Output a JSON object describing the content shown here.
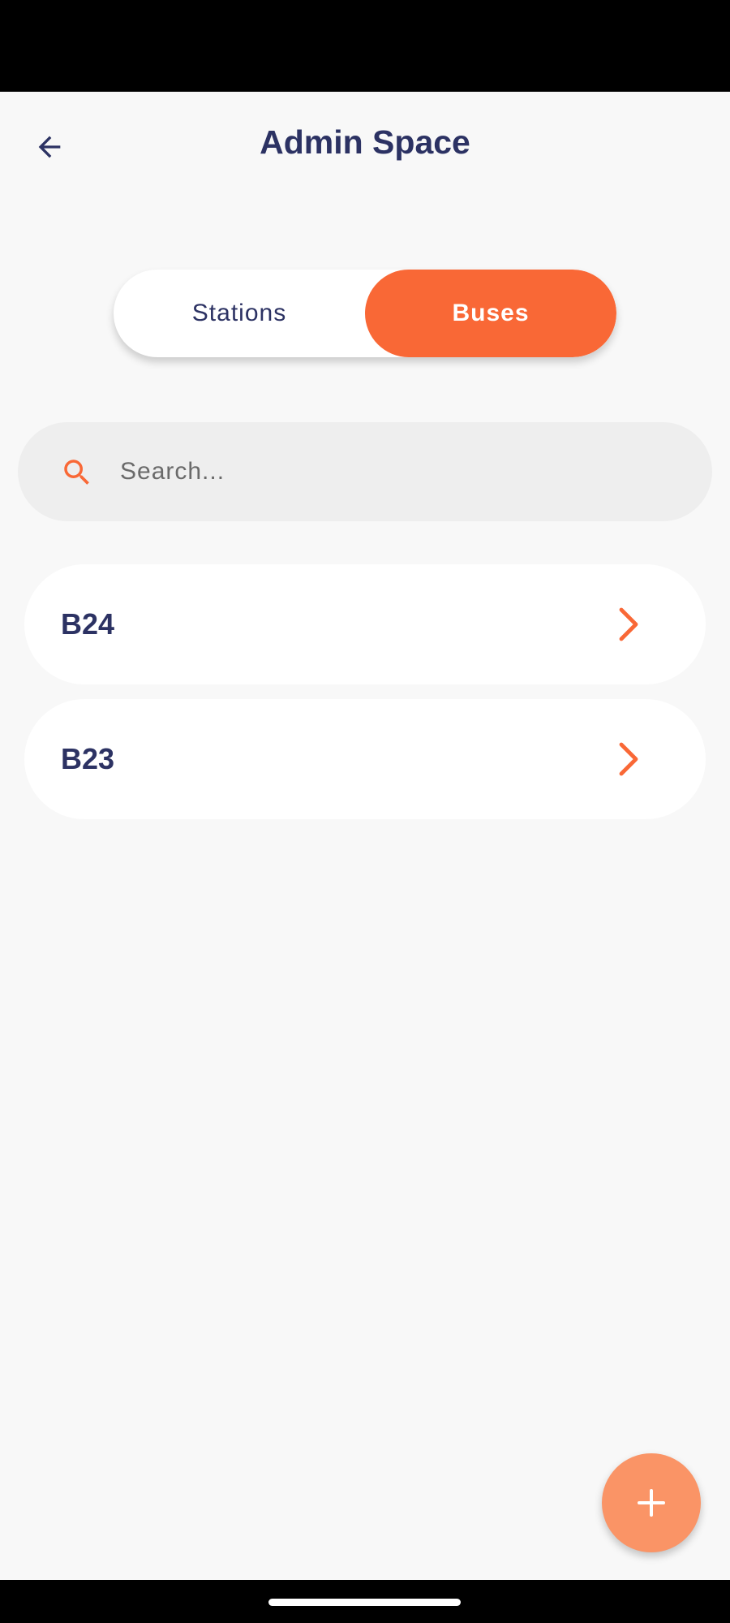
{
  "header": {
    "title": "Admin Space",
    "back_icon": "arrow-left-icon"
  },
  "tabs": [
    {
      "label": "Stations",
      "active": false
    },
    {
      "label": "Buses",
      "active": true
    }
  ],
  "search": {
    "placeholder": "Search...",
    "value": "",
    "icon": "search-icon"
  },
  "buses": [
    {
      "name": "B24",
      "icon": "chevron-right-icon"
    },
    {
      "name": "B23",
      "icon": "chevron-right-icon"
    }
  ],
  "fab": {
    "icon": "plus-icon"
  },
  "colors": {
    "accent": "#f96836",
    "fab": "#fa9466",
    "text_primary": "#2c3263",
    "background": "#f8f8f8",
    "search_bg": "#eeeeee"
  }
}
